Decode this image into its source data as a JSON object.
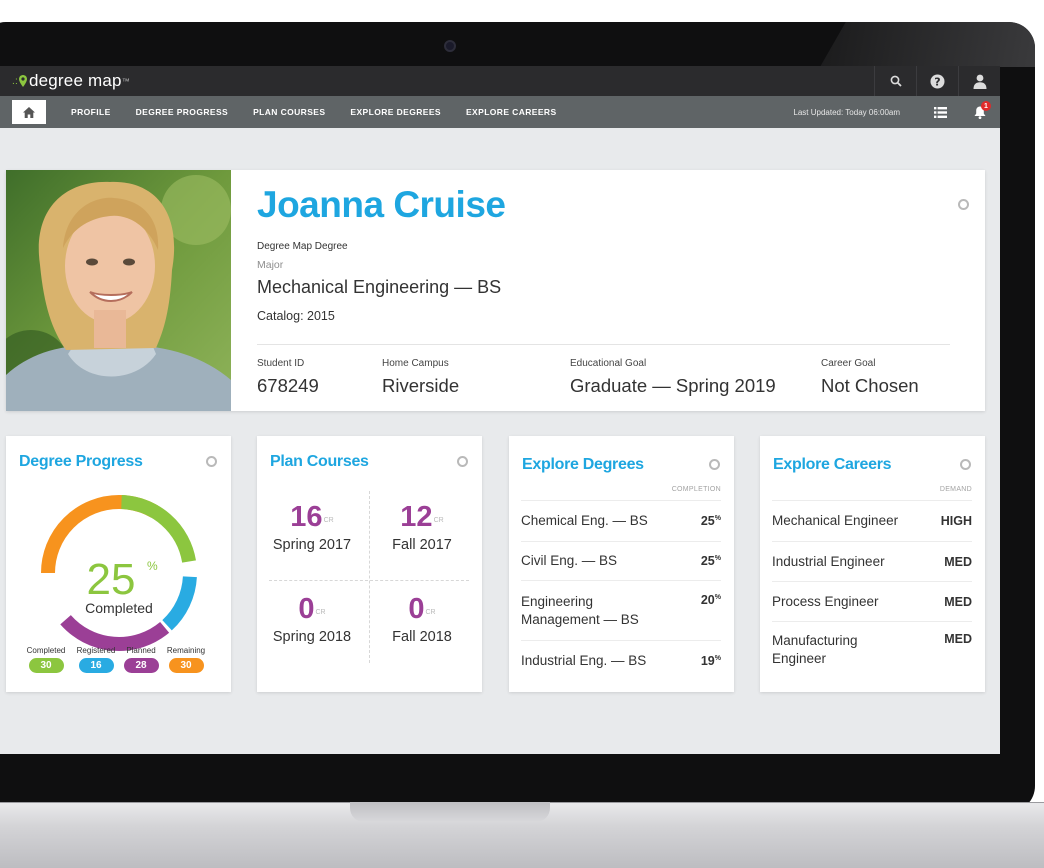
{
  "app": {
    "logo": "degree map",
    "logo_tm": "™"
  },
  "topbar": {
    "icons": [
      "search-icon",
      "help-icon",
      "user-icon"
    ]
  },
  "nav": {
    "items": [
      "PROFILE",
      "DEGREE PROGRESS",
      "PLAN COURSES",
      "EXPLORE DEGREES",
      "EXPLORE CAREERS"
    ],
    "last_updated": "Last Updated: Today 06:00am",
    "notification_count": "1"
  },
  "profile": {
    "name": "Joanna Cruise",
    "degree_label": "Degree Map Degree",
    "major_label": "Major",
    "major": "Mechanical Engineering — BS",
    "catalog": "Catalog: 2015",
    "fields": [
      {
        "label": "Student ID",
        "value": "678249"
      },
      {
        "label": "Home Campus",
        "value": "Riverside"
      },
      {
        "label": "Educational Goal",
        "value": "Graduate — Spring 2019"
      },
      {
        "label": "Career Goal",
        "value": "Not Chosen"
      }
    ]
  },
  "degree_progress": {
    "title": "Degree Progress",
    "percent": "25",
    "percent_sign": "%",
    "status": "Completed",
    "percent_value": 25,
    "legend": [
      {
        "label": "Completed",
        "value": "30",
        "color": "#8cc63f"
      },
      {
        "label": "Registered",
        "value": "16",
        "color": "#29abe2"
      },
      {
        "label": "Planned",
        "value": "28",
        "color": "#9b3f96"
      },
      {
        "label": "Remaining",
        "value": "30",
        "color": "#f7931e"
      }
    ]
  },
  "plan_courses": {
    "title": "Plan Courses",
    "unit": "CR",
    "terms": [
      {
        "credits": "16",
        "term": "Spring 2017"
      },
      {
        "credits": "12",
        "term": "Fall 2017"
      },
      {
        "credits": "0",
        "term": "Spring 2018"
      },
      {
        "credits": "0",
        "term": "Fall 2018"
      }
    ]
  },
  "explore_degrees": {
    "title": "Explore Degrees",
    "column": "COMPLETION",
    "rows": [
      {
        "name": "Chemical Eng. — BS",
        "value": "25",
        "unit": "%"
      },
      {
        "name": "Civil Eng. — BS",
        "value": "25",
        "unit": "%"
      },
      {
        "name": "Engineering Management — BS",
        "value": "20",
        "unit": "%"
      },
      {
        "name": "Industrial Eng. — BS",
        "value": "19",
        "unit": "%"
      }
    ]
  },
  "explore_careers": {
    "title": "Explore Careers",
    "column": "DEMAND",
    "rows": [
      {
        "name": "Mechanical Engineer",
        "value": "HIGH"
      },
      {
        "name": "Industrial Engineer",
        "value": "MED"
      },
      {
        "name": "Process Engineer",
        "value": "MED"
      },
      {
        "name": "Manufacturing Engineer",
        "value": "MED"
      }
    ]
  },
  "colors": {
    "accent": "#1ea6e0",
    "purple": "#9b3f96",
    "green": "#8cc63f",
    "blue": "#29abe2",
    "orange": "#f7931e"
  }
}
